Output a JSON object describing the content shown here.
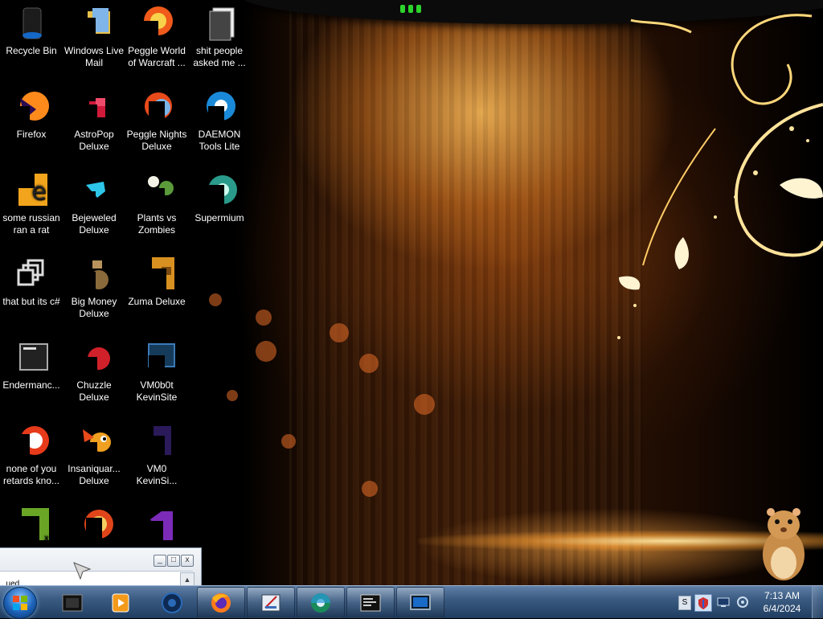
{
  "desktop": {
    "icons": [
      {
        "id": "recycle-bin",
        "label": "Recycle Bin"
      },
      {
        "id": "windows-live-mail",
        "label": "Windows Live\nMail"
      },
      {
        "id": "peggle-world",
        "label": "Peggle World\nof Warcraft ..."
      },
      {
        "id": "shit-people-folder",
        "label": "shit people\nasked me ..."
      },
      {
        "id": "firefox",
        "label": "Firefox"
      },
      {
        "id": "astropop",
        "label": "AstroPop\nDeluxe"
      },
      {
        "id": "peggle-nights",
        "label": "Peggle Nights\nDeluxe"
      },
      {
        "id": "daemon-tools",
        "label": "DAEMON\nTools Lite"
      },
      {
        "id": "russian-rat",
        "label": "some russian\nran a rat"
      },
      {
        "id": "bejeweled",
        "label": "Bejeweled\nDeluxe"
      },
      {
        "id": "plants-vs-zombies",
        "label": "Plants vs\nZombies"
      },
      {
        "id": "supermium",
        "label": "Supermium"
      },
      {
        "id": "that-but-csharp",
        "label": "that but its c#"
      },
      {
        "id": "big-money",
        "label": "Big Money\nDeluxe"
      },
      {
        "id": "zuma",
        "label": "Zuma Deluxe"
      },
      {
        "id": "endermanch",
        "label": "Endermanc..."
      },
      {
        "id": "chuzzle",
        "label": "Chuzzle\nDeluxe"
      },
      {
        "id": "vm0b0t",
        "label": "VM0b0t\nKevinSite"
      },
      {
        "id": "none-of-you",
        "label": "none of you\nretards kno..."
      },
      {
        "id": "insaniquarium",
        "label": "Insaniquar...\nDeluxe"
      },
      {
        "id": "vm0-kevinsi",
        "label": "VM0\nKevinSi..."
      }
    ]
  },
  "window": {
    "minimize_glyph": "_",
    "maximize_glyph": "□",
    "close_glyph": "x",
    "partial_text": "..ued",
    "scroll_up_glyph": "▲"
  },
  "taskbar": {
    "clock_time": "7:13 AM",
    "clock_date": "6/4/2024"
  },
  "colors": {
    "taskbar_top": "#5f7fa6",
    "taskbar_bottom": "#203d60",
    "icon_label": "#ffffff"
  }
}
